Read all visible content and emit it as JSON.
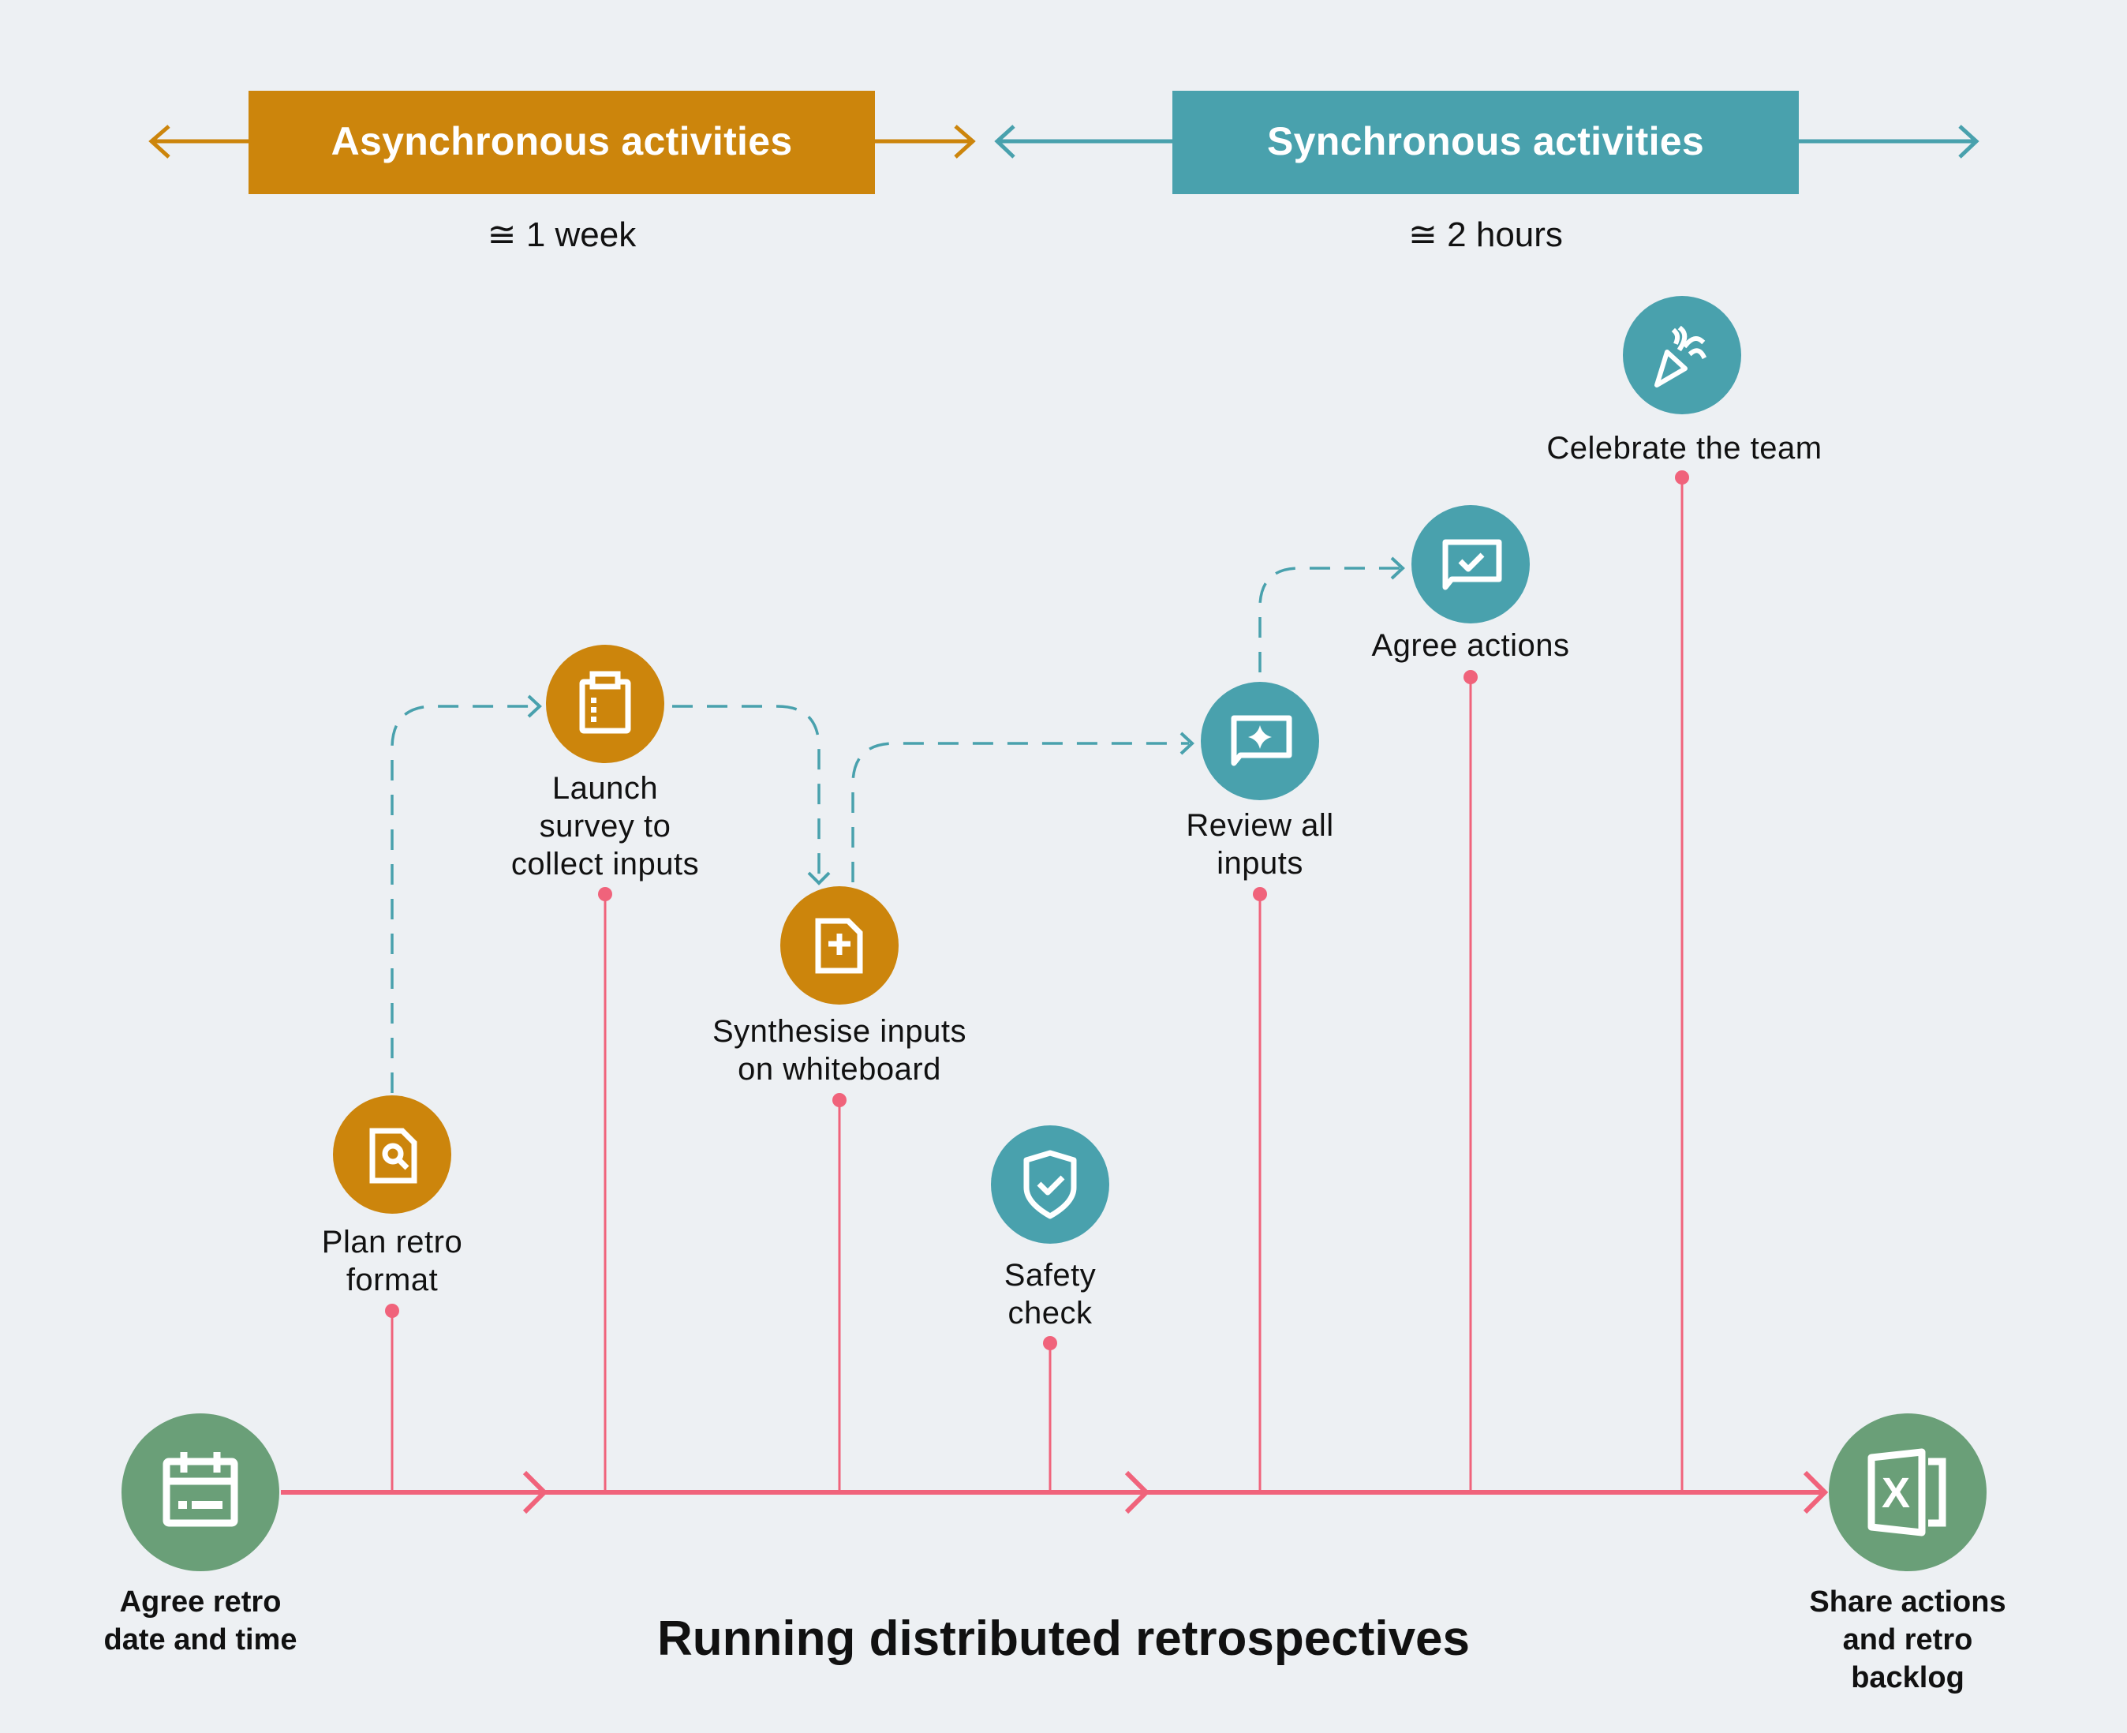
{
  "title": "Running distributed retrospectives",
  "colors": {
    "async": "#cc850c",
    "sync": "#49a1ad",
    "endpoint": "#6a9f78",
    "timeline": "#f0637b",
    "background": "#edf0f3",
    "text": "#111111"
  },
  "phases": [
    {
      "id": "async",
      "label": "Asynchronous activities",
      "duration": "≅ 1 week"
    },
    {
      "id": "sync",
      "label": "Synchronous activities",
      "duration": "≅ 2 hours"
    }
  ],
  "start": {
    "label": "Agree retro\ndate and time",
    "icon": "calendar-icon"
  },
  "end": {
    "label": "Share actions\nand retro backlog",
    "icon": "spreadsheet-icon"
  },
  "steps": [
    {
      "id": "plan",
      "label": "Plan retro\nformat",
      "phase": "async",
      "icon": "document-search-icon"
    },
    {
      "id": "launch",
      "label": "Launch\nsurvey to\ncollect inputs",
      "phase": "async",
      "icon": "clipboard-icon"
    },
    {
      "id": "synthesise",
      "label": "Synthesise inputs\non whiteboard",
      "phase": "async",
      "icon": "document-add-icon"
    },
    {
      "id": "safety",
      "label": "Safety\ncheck",
      "phase": "sync",
      "icon": "shield-check-icon"
    },
    {
      "id": "review",
      "label": "Review all\ninputs",
      "phase": "sync",
      "icon": "chat-sparkle-icon"
    },
    {
      "id": "agree",
      "label": "Agree actions",
      "phase": "sync",
      "icon": "chat-check-icon"
    },
    {
      "id": "celebrate",
      "label": "Celebrate the team",
      "phase": "sync",
      "icon": "party-popper-icon"
    }
  ],
  "flows": [
    {
      "from": "plan",
      "to": "launch"
    },
    {
      "from": "launch",
      "to": "synthesise"
    },
    {
      "from": "synthesise",
      "to": "review"
    },
    {
      "from": "review",
      "to": "agree"
    }
  ]
}
